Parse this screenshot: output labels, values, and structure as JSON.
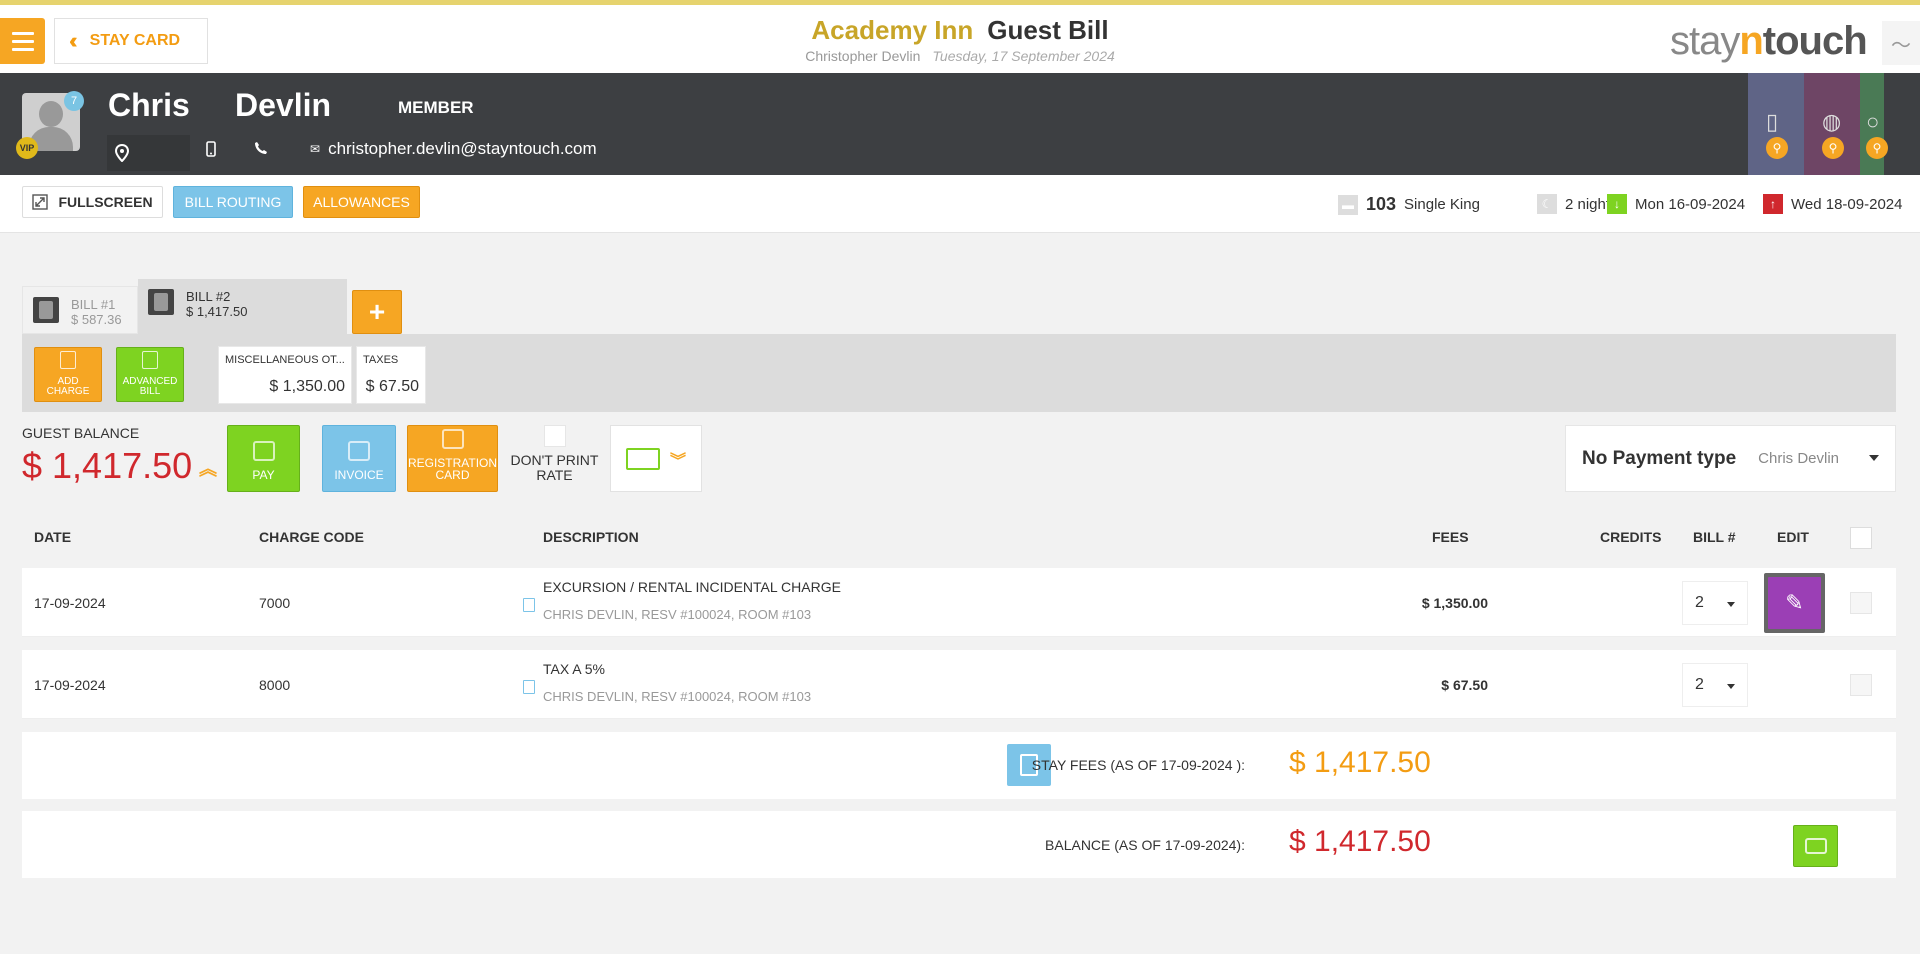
{
  "header": {
    "stay_card_label": "STAY CARD",
    "hotel_name": "Academy Inn",
    "page_title": "Guest Bill",
    "guest_name": "Christopher Devlin",
    "date": "Tuesday, 17 September 2024",
    "logo_pre": "stay",
    "logo_n": "n",
    "logo_post": "touch"
  },
  "guest": {
    "first_name": "Chris",
    "last_name": "Devlin",
    "membership": "MEMBER",
    "badge_count": "7",
    "vip": "VIP",
    "email": "christopher.devlin@stayntouch.com"
  },
  "stay_bar": {
    "fullscreen_label": "FULLSCREEN",
    "bill_routing_label": "BILL ROUTING",
    "allowances_label": "ALLOWANCES",
    "room_number": "103",
    "room_type": "Single King",
    "nights": "2 nights",
    "arrival": "Mon 16-09-2024",
    "departure": "Wed 18-09-2024"
  },
  "bills": {
    "tabs": [
      {
        "label": "BILL #1",
        "amount": "$ 587.36"
      },
      {
        "label": "BILL #2",
        "amount": "$ 1,417.50"
      }
    ],
    "add_label": "+",
    "actions": {
      "add_charge": "ADD CHARGE",
      "advanced_bill": "ADVANCED BILL"
    },
    "summary": [
      {
        "label": "MISCELLANEOUS OT...",
        "amount": "$ 1,350.00"
      },
      {
        "label": "TAXES",
        "amount": "$ 67.50"
      }
    ]
  },
  "balance": {
    "label": "GUEST BALANCE",
    "amount": "$ 1,417.50",
    "pay_label": "PAY",
    "invoice_label": "INVOICE",
    "registration_label": "REGISTRATION CARD",
    "dont_print_label": "DON'T PRINT RATE",
    "payment_type": "No Payment type",
    "payment_name": "Chris Devlin"
  },
  "table": {
    "headers": {
      "date": "DATE",
      "charge_code": "CHARGE CODE",
      "description": "DESCRIPTION",
      "fees": "FEES",
      "credits": "CREDITS",
      "bill_no": "BILL #",
      "edit": "EDIT"
    },
    "rows": [
      {
        "date": "17-09-2024",
        "code": "7000",
        "desc": "EXCURSION / RENTAL INCIDENTAL CHARGE",
        "sub": "CHRIS DEVLIN, RESV #100024, ROOM #103",
        "fees": "$ 1,350.00",
        "credits": "",
        "bill": "2"
      },
      {
        "date": "17-09-2024",
        "code": "8000",
        "desc": "TAX A 5%",
        "sub": "CHRIS DEVLIN, RESV #100024, ROOM #103",
        "fees": "$ 67.50",
        "credits": "",
        "bill": "2"
      }
    ]
  },
  "totals": {
    "stay_fees_label": "STAY FEES (AS OF  17-09-2024 ):",
    "stay_fees_amount": "$ 1,417.50",
    "balance_label": "BALANCE (AS OF  17-09-2024):",
    "balance_amount": "$ 1,417.50"
  },
  "colors": {
    "accent_orange": "#f6a623",
    "accent_blue": "#7cc4e8",
    "accent_green": "#7ed321",
    "balance_red": "#d0282d",
    "edit_purple": "#9b3fb5",
    "guest_band": "#3d3f42"
  },
  "icons": [
    "menu-icon",
    "double-chevron-left-icon",
    "activity-icon",
    "location-icon",
    "mobile-icon",
    "phone-icon",
    "envelope-icon",
    "fullscreen-icon",
    "bed-icon",
    "moon-icon",
    "arrival-arrow-icon",
    "departure-arrow-icon",
    "pencil-icon",
    "wallet-icon",
    "receipt-icon"
  ]
}
